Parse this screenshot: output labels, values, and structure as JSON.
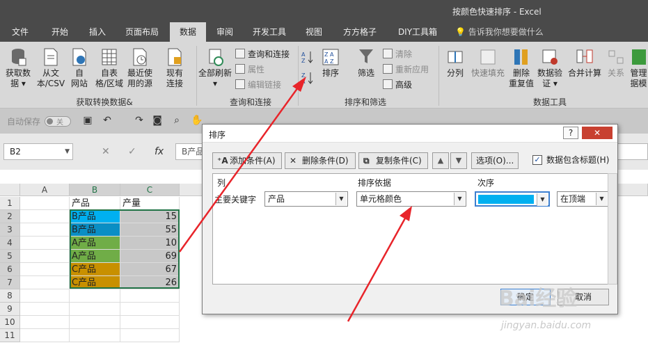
{
  "window": {
    "title": "按颜色快速排序 - Excel"
  },
  "tabs": [
    "文件",
    "开始",
    "插入",
    "页面布局",
    "数据",
    "审阅",
    "开发工具",
    "视图",
    "方方格子",
    "DIY工具箱"
  ],
  "active_tab": "数据",
  "tell_me": "告诉我你想要做什么",
  "ribbon": {
    "get_data": {
      "b1": "获取数",
      "b1b": "据 ▾",
      "b2": "从文",
      "b2b": "本/CSV",
      "b3": "自",
      "b3b": "网站",
      "b4": "自表",
      "b4b": "格/区域",
      "b5": "最近使",
      "b5b": "用的源",
      "b6": "现有",
      "b6b": "连接",
      "group": "获取转换数据&"
    },
    "queries": {
      "refresh": "全部刷新",
      "refresh_b": "▾",
      "qc": "查询和连接",
      "props": "属性",
      "edit_links": "编辑链接",
      "group": "查询和连接"
    },
    "sort": {
      "az": "A→Z",
      "za": "Z→A",
      "sort": "排序",
      "filter": "筛选",
      "clear": "清除",
      "reapply": "重新应用",
      "advanced": "高级",
      "group": "排序和筛选"
    },
    "tools": {
      "split": "分列",
      "flash": "快速填充",
      "dup": "删除",
      "dup_b": "重复值",
      "valid": "数据验",
      "valid_b": "证 ▾",
      "merge": "合并计算",
      "rel": "关系",
      "mgmt": "管理",
      "mgmt_b": "据模",
      "group": "数据工具"
    }
  },
  "qat": {
    "autosave": "自动保存",
    "toggle": "关"
  },
  "name_box": "B2",
  "formula_peek": "B产品",
  "columns": [
    "A",
    "B",
    "C"
  ],
  "rows": [
    "1",
    "2",
    "3",
    "4",
    "5",
    "6",
    "7",
    "8",
    "9",
    "10",
    "11"
  ],
  "sheet": {
    "headers": [
      "产品",
      "产量"
    ],
    "data": [
      {
        "product": "B产品",
        "qty": "15",
        "color": "#00b0f0"
      },
      {
        "product": "B产品",
        "qty": "55",
        "color": "#0a8ec4"
      },
      {
        "product": "A产品",
        "qty": "10",
        "color": "#70ad47"
      },
      {
        "product": "A产品",
        "qty": "69",
        "color": "#70ad47"
      },
      {
        "product": "C产品",
        "qty": "67",
        "color": "#c89000"
      },
      {
        "product": "C产品",
        "qty": "26",
        "color": "#c89000"
      }
    ]
  },
  "dialog": {
    "title": "排序",
    "help": "?",
    "add": "添加条件(A)",
    "delete": "删除条件(D)",
    "copy": "复制条件(C)",
    "options": "选项(O)...",
    "has_header_label": "数据包含标题(H)",
    "col_header": "列",
    "basis_header": "排序依据",
    "order_header": "次序",
    "row_label": "主要关键字",
    "row_column": "产品",
    "row_basis": "单元格颜色",
    "row_color": "#00b0f0",
    "row_position": "在顶端",
    "ok": "确定",
    "cancel": "取消"
  },
  "watermark": {
    "brand": "Bai经验",
    "url": "jingyan.baidu.com"
  }
}
